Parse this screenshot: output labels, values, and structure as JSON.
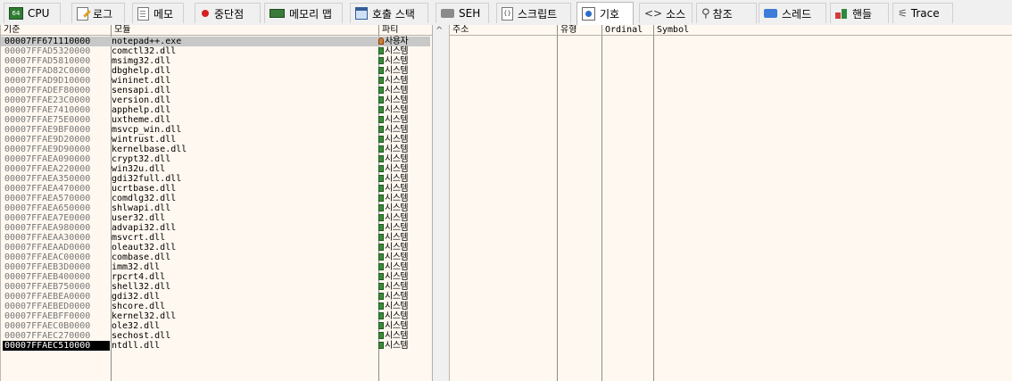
{
  "tabs": [
    {
      "label": "CPU",
      "icon": "cpu-icon"
    },
    {
      "label": "로그",
      "icon": "log-icon"
    },
    {
      "label": "메모",
      "icon": "notes-icon"
    },
    {
      "label": "중단점",
      "icon": "breakpoint-icon"
    },
    {
      "label": "메모리 맵",
      "icon": "memory-map-icon"
    },
    {
      "label": "호출 스택",
      "icon": "call-stack-icon"
    },
    {
      "label": "SEH",
      "icon": "seh-icon"
    },
    {
      "label": "스크립트",
      "icon": "script-icon"
    },
    {
      "label": "기호",
      "icon": "symbols-icon",
      "active": true
    },
    {
      "label": "소스",
      "icon": "source-icon"
    },
    {
      "label": "참조",
      "icon": "references-icon"
    },
    {
      "label": "스레드",
      "icon": "threads-icon"
    },
    {
      "label": "핸들",
      "icon": "handles-icon"
    },
    {
      "label": "Trace",
      "icon": "trace-icon"
    }
  ],
  "modules_pane": {
    "headers": {
      "base": "기준",
      "module": "모듈",
      "party": "파티"
    },
    "rows": [
      {
        "base": "00007FF671110000",
        "module": "notepad++.exe",
        "party": "사용자",
        "user": true,
        "selected": true
      },
      {
        "base": "00007FFAD5320000",
        "module": "comctl32.dll",
        "party": "시스템"
      },
      {
        "base": "00007FFAD5810000",
        "module": "msimg32.dll",
        "party": "시스템"
      },
      {
        "base": "00007FFAD82C0000",
        "module": "dbghelp.dll",
        "party": "시스템"
      },
      {
        "base": "00007FFAD9D10000",
        "module": "wininet.dll",
        "party": "시스템"
      },
      {
        "base": "00007FFADEF80000",
        "module": "sensapi.dll",
        "party": "시스템"
      },
      {
        "base": "00007FFAE23C0000",
        "module": "version.dll",
        "party": "시스템"
      },
      {
        "base": "00007FFAE7410000",
        "module": "apphelp.dll",
        "party": "시스템"
      },
      {
        "base": "00007FFAE75E0000",
        "module": "uxtheme.dll",
        "party": "시스템"
      },
      {
        "base": "00007FFAE9BF0000",
        "module": "msvcp_win.dll",
        "party": "시스템"
      },
      {
        "base": "00007FFAE9D20000",
        "module": "wintrust.dll",
        "party": "시스템"
      },
      {
        "base": "00007FFAE9D90000",
        "module": "kernelbase.dll",
        "party": "시스템"
      },
      {
        "base": "00007FFAEA090000",
        "module": "crypt32.dll",
        "party": "시스템"
      },
      {
        "base": "00007FFAEA220000",
        "module": "win32u.dll",
        "party": "시스템"
      },
      {
        "base": "00007FFAEA350000",
        "module": "gdi32full.dll",
        "party": "시스템"
      },
      {
        "base": "00007FFAEA470000",
        "module": "ucrtbase.dll",
        "party": "시스템"
      },
      {
        "base": "00007FFAEA570000",
        "module": "comdlg32.dll",
        "party": "시스템"
      },
      {
        "base": "00007FFAEA650000",
        "module": "shlwapi.dll",
        "party": "시스템"
      },
      {
        "base": "00007FFAEA7E0000",
        "module": "user32.dll",
        "party": "시스템"
      },
      {
        "base": "00007FFAEA980000",
        "module": "advapi32.dll",
        "party": "시스템"
      },
      {
        "base": "00007FFAEAA30000",
        "module": "msvcrt.dll",
        "party": "시스템"
      },
      {
        "base": "00007FFAEAAD0000",
        "module": "oleaut32.dll",
        "party": "시스템"
      },
      {
        "base": "00007FFAEAC00000",
        "module": "combase.dll",
        "party": "시스템"
      },
      {
        "base": "00007FFAEB3D0000",
        "module": "imm32.dll",
        "party": "시스템"
      },
      {
        "base": "00007FFAEB400000",
        "module": "rpcrt4.dll",
        "party": "시스템"
      },
      {
        "base": "00007FFAEB750000",
        "module": "shell32.dll",
        "party": "시스템"
      },
      {
        "base": "00007FFAEBEA0000",
        "module": "gdi32.dll",
        "party": "시스템"
      },
      {
        "base": "00007FFAEBED0000",
        "module": "shcore.dll",
        "party": "시스템"
      },
      {
        "base": "00007FFAEBFF0000",
        "module": "kernel32.dll",
        "party": "시스템"
      },
      {
        "base": "00007FFAEC0B0000",
        "module": "ole32.dll",
        "party": "시스템"
      },
      {
        "base": "00007FFAEC270000",
        "module": "sechost.dll",
        "party": "시스템"
      },
      {
        "base": "00007FFAEC510000",
        "module": "ntdll.dll",
        "party": "시스템",
        "current": true
      }
    ]
  },
  "symbols_pane": {
    "headers": {
      "address": "주소",
      "type": "유형",
      "ordinal": "Ordinal",
      "symbol": "Symbol"
    },
    "collapse_glyph": "^"
  },
  "colors": {
    "pane_bg": "#fff8f0",
    "selected_row": "#c8c8c8",
    "current_row": "#000000"
  }
}
